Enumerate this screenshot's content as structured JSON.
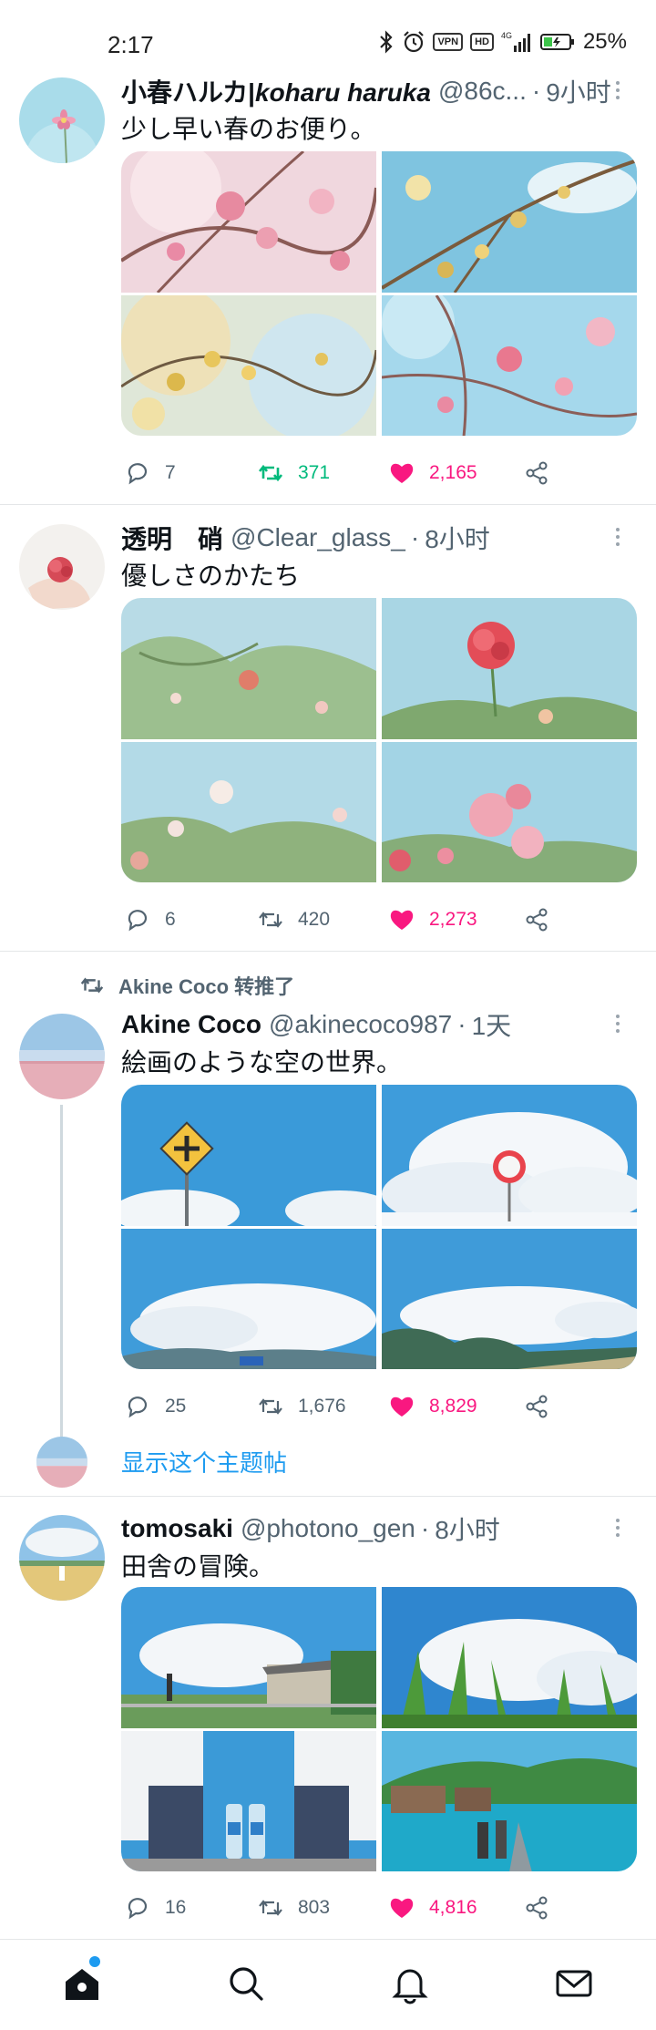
{
  "status_bar": {
    "time": "2:17",
    "icons": [
      "bluetooth-icon",
      "alarm-icon",
      "vpn-icon",
      "hd-icon",
      "signal-4g-icon",
      "battery-icon"
    ],
    "vpn": "VPN",
    "hd": "HD",
    "network": "4G",
    "battery": "25%"
  },
  "tweets": [
    {
      "display_name": "小春ハルカ|",
      "display_name_italic": "koharu haruka",
      "handle": "@86c...",
      "dot": "·",
      "time_ago": "9小时",
      "text": "少し早い春のお便り。",
      "replies": "7",
      "retweets": "371",
      "likes": "2,165",
      "retweeted_by_me": true,
      "liked": true
    },
    {
      "display_name": "透明　硝",
      "display_name_italic": "",
      "handle": "@Clear_glass_",
      "dot": "·",
      "time_ago": "8小时",
      "text": "優しさのかたち",
      "replies": "6",
      "retweets": "420",
      "likes": "2,273",
      "retweeted_by_me": false,
      "liked": true
    },
    {
      "retweet_label": "Akine Coco 转推了",
      "display_name": "Akine Coco",
      "display_name_italic": "",
      "handle": "@akinecoco987",
      "dot": "·",
      "time_ago": "1天",
      "text": "絵画のような空の世界。",
      "replies": "25",
      "retweets": "1,676",
      "likes": "8,829",
      "retweeted_by_me": false,
      "liked": true,
      "show_thread": "显示这个主题帖"
    },
    {
      "display_name": "tomosaki",
      "display_name_italic": "",
      "handle": "@photono_gen",
      "dot": "·",
      "time_ago": "8小时",
      "text": "田舎の冒険。",
      "replies": "16",
      "retweets": "803",
      "likes": "4,816",
      "retweeted_by_me": false,
      "liked": true
    }
  ],
  "bottom_nav": {
    "items": [
      "home-icon",
      "search-icon",
      "notifications-icon",
      "messages-icon"
    ],
    "active": "home-icon"
  },
  "colors": {
    "accent": "#1d9bf0",
    "like": "#f91880",
    "retweet": "#00ba7c",
    "secondary_text": "#536471"
  }
}
